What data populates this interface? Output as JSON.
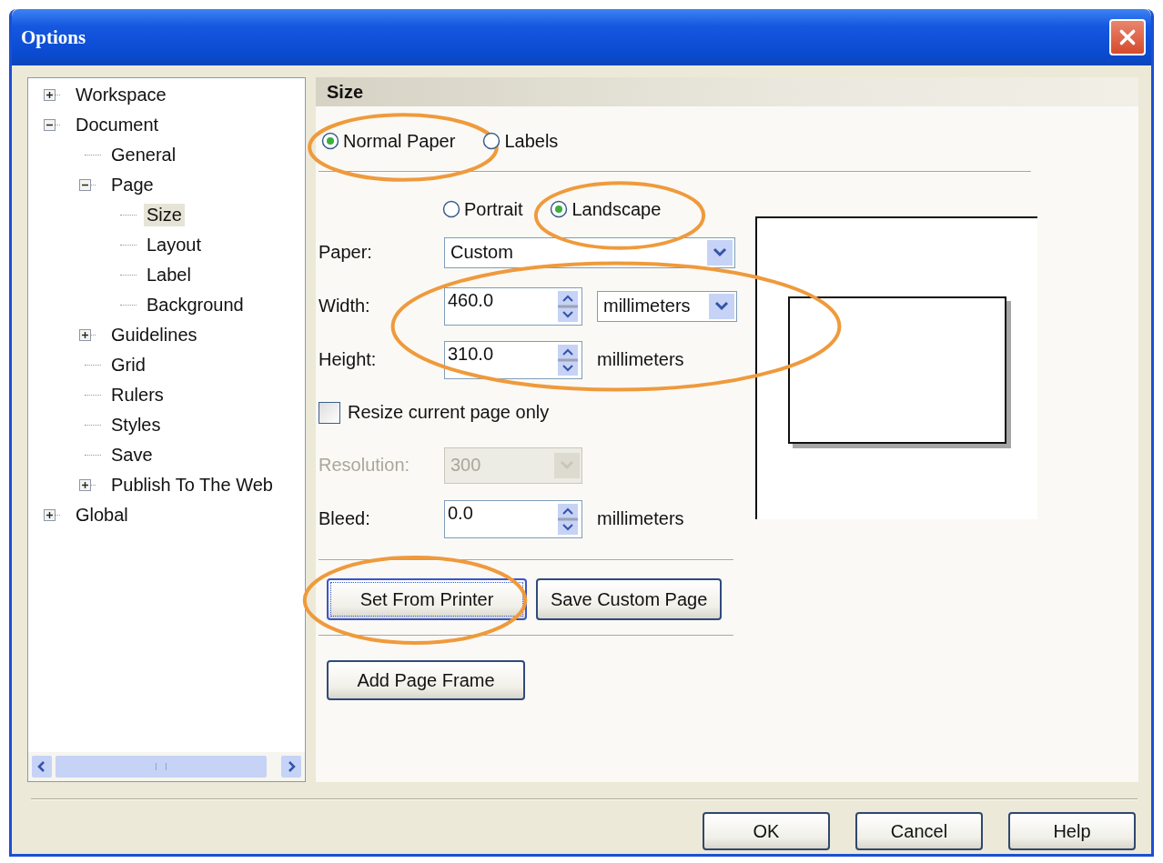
{
  "window": {
    "title": "Options"
  },
  "tree": {
    "items": [
      {
        "label": "Workspace",
        "kind": "node",
        "expanded": false,
        "selected": false
      },
      {
        "label": "Document",
        "kind": "node",
        "expanded": true,
        "selected": false,
        "children": [
          {
            "label": "General",
            "kind": "leaf",
            "selected": false
          },
          {
            "label": "Page",
            "kind": "node",
            "expanded": true,
            "selected": false,
            "children": [
              {
                "label": "Size",
                "kind": "leaf",
                "selected": true
              },
              {
                "label": "Layout",
                "kind": "leaf",
                "selected": false
              },
              {
                "label": "Label",
                "kind": "leaf",
                "selected": false
              },
              {
                "label": "Background",
                "kind": "leaf",
                "selected": false
              }
            ]
          },
          {
            "label": "Guidelines",
            "kind": "node",
            "expanded": false,
            "selected": false
          },
          {
            "label": "Grid",
            "kind": "leaf",
            "selected": false
          },
          {
            "label": "Rulers",
            "kind": "leaf",
            "selected": false
          },
          {
            "label": "Styles",
            "kind": "leaf",
            "selected": false
          },
          {
            "label": "Save",
            "kind": "leaf",
            "selected": false
          },
          {
            "label": "Publish To The Web",
            "kind": "node",
            "expanded": false,
            "selected": false
          }
        ]
      },
      {
        "label": "Global",
        "kind": "node",
        "expanded": false,
        "selected": false
      }
    ]
  },
  "panel": {
    "title": "Size",
    "paper_type": [
      {
        "label": "Normal Paper",
        "selected": true,
        "circled": true
      },
      {
        "label": "Labels",
        "selected": false,
        "circled": false
      }
    ],
    "orientation": [
      {
        "label": "Portrait",
        "selected": false,
        "circled": false
      },
      {
        "label": "Landscape",
        "selected": true,
        "circled": true
      }
    ],
    "paper": {
      "label": "Paper:",
      "value": "Custom"
    },
    "size_fields": {
      "circled": true,
      "width": {
        "label": "Width:",
        "value": "460.0",
        "unit": "millimeters"
      },
      "height": {
        "label": "Height:",
        "value": "310.0",
        "unit": "millimeters"
      }
    },
    "resize_current_page_only": {
      "label": "Resize current page only",
      "checked": false
    },
    "resolution": {
      "label": "Resolution:",
      "value": "300",
      "disabled": true
    },
    "bleed": {
      "label": "Bleed:",
      "value": "0.0",
      "unit": "millimeters"
    },
    "page_buttons": [
      {
        "label": "Set From Printer",
        "focused": true,
        "circled": true
      },
      {
        "label": "Save Custom Page",
        "focused": false,
        "circled": false
      }
    ],
    "frame_button": {
      "label": "Add Page Frame"
    }
  },
  "buttons": [
    "OK",
    "Cancel",
    "Help"
  ]
}
